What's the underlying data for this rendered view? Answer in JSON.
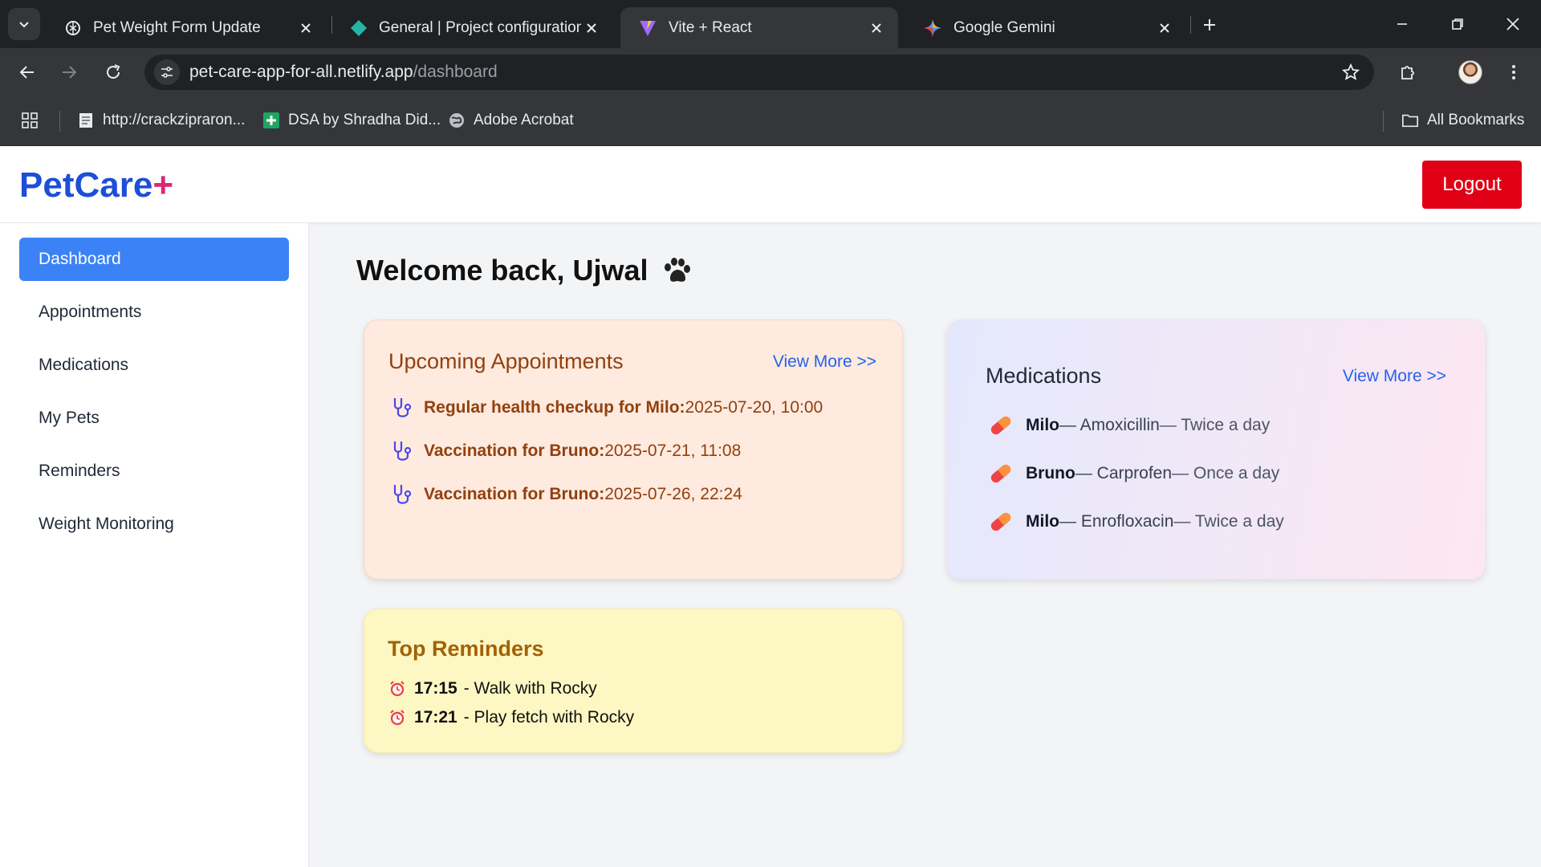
{
  "browser": {
    "tabs": [
      {
        "title": "Pet Weight Form Update",
        "icon": "openai-icon"
      },
      {
        "title": "General | Project configuration |",
        "icon": "netlify-icon"
      },
      {
        "title": "Vite + React",
        "icon": "vite-icon",
        "active": true
      },
      {
        "title": "Google Gemini",
        "icon": "gemini-icon"
      }
    ],
    "url_host": "pet-care-app-for-all.netlify.app",
    "url_path": "/dashboard",
    "bookmarks": [
      {
        "label": "http://crackzipraron...",
        "icon": "page-icon"
      },
      {
        "label": "DSA by Shradha Did...",
        "icon": "sheets-plus-icon"
      },
      {
        "label": "Adobe Acrobat",
        "icon": "globe-icon"
      }
    ],
    "all_bookmarks": "All Bookmarks"
  },
  "app": {
    "logo_text": "PetCare",
    "logo_plus": "+",
    "logout_label": "Logout",
    "sidebar": [
      {
        "label": "Dashboard",
        "active": true
      },
      {
        "label": "Appointments"
      },
      {
        "label": "Medications"
      },
      {
        "label": "My Pets"
      },
      {
        "label": "Reminders"
      },
      {
        "label": "Weight Monitoring"
      }
    ],
    "welcome": "Welcome back, Ujwal",
    "appointments": {
      "title": "Upcoming Appointments",
      "view_more": "View More >>",
      "items": [
        {
          "title": "Regular health checkup for Milo:",
          "when": " 2025-07-20, 10:00"
        },
        {
          "title": "Vaccination for Bruno:",
          "when": " 2025-07-21, 11:08"
        },
        {
          "title": "Vaccination for Bruno:",
          "when": " 2025-07-26, 22:24"
        }
      ]
    },
    "medications": {
      "title": "Medications",
      "view_more": "View More >>",
      "items": [
        {
          "pet": "Milo",
          "drug": "— Amoxicillin",
          "freq": "— Twice a day"
        },
        {
          "pet": "Bruno",
          "drug": "— Carprofen",
          "freq": "— Once a day"
        },
        {
          "pet": "Milo",
          "drug": "— Enrofloxacin",
          "freq": "— Twice a day"
        }
      ]
    },
    "reminders": {
      "title": "Top Reminders",
      "items": [
        {
          "time": "17:15",
          "text": "- Walk with Rocky"
        },
        {
          "time": "17:21",
          "text": "- Play fetch with Rocky"
        }
      ]
    },
    "colors": {
      "brand_blue": "#1d4ed8",
      "brand_pink": "#db2777",
      "active_nav": "#3b82f6",
      "logout_red": "#e00015",
      "appointment_text": "#92400e"
    }
  }
}
